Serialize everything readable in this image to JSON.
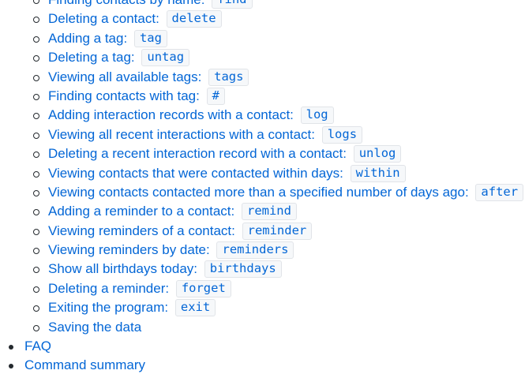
{
  "sub_items": [
    {
      "label": "Finding contacts by name:",
      "command": "find"
    },
    {
      "label": "Deleting a contact:",
      "command": "delete"
    },
    {
      "label": "Adding a tag:",
      "command": "tag"
    },
    {
      "label": "Deleting a tag:",
      "command": "untag"
    },
    {
      "label": "Viewing all available tags:",
      "command": "tags"
    },
    {
      "label": "Finding contacts with tag:",
      "command": "#"
    },
    {
      "label": "Adding interaction records with a contact:",
      "command": "log"
    },
    {
      "label": "Viewing all recent interactions with a contact:",
      "command": "logs"
    },
    {
      "label": "Deleting a recent interaction record with a contact:",
      "command": "unlog"
    },
    {
      "label": "Viewing contacts that were contacted within days:",
      "command": "within"
    },
    {
      "label": "Viewing contacts contacted more than a specified number of days ago:",
      "command": "after"
    },
    {
      "label": "Adding a reminder to a contact:",
      "command": "remind"
    },
    {
      "label": "Viewing reminders of a contact:",
      "command": "reminder"
    },
    {
      "label": "Viewing reminders by date:",
      "command": "reminders"
    },
    {
      "label": "Show all birthdays today:",
      "command": "birthdays"
    },
    {
      "label": "Deleting a reminder:",
      "command": "forget"
    },
    {
      "label": "Exiting the program:",
      "command": "exit"
    },
    {
      "label": "Saving the data",
      "command": ""
    }
  ],
  "top_items": [
    {
      "label": "FAQ"
    },
    {
      "label": "Command summary"
    }
  ],
  "colors": {
    "link": "#0366d6",
    "text": "#24292e",
    "code_background": "#f6f8fa",
    "code_border": "#e1e4e8"
  }
}
